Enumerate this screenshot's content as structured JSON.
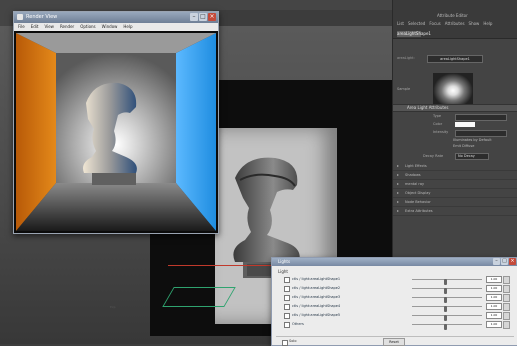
{
  "render_window": {
    "title": "Render View",
    "menu": [
      "File",
      "Edit",
      "View",
      "Render",
      "Options",
      "Window",
      "Help"
    ],
    "left_wall_color": "#e4891a",
    "right_wall_color": "#1f8de0"
  },
  "viewport": {
    "wall_color": "#c2c2c2",
    "shadow_color": "#0d0d0d"
  },
  "attribute_editor": {
    "title": "Attribute Editor",
    "tabs": [
      "List",
      "Selected",
      "Focus",
      "Attributes",
      "Show",
      "Help"
    ],
    "node_tab": "areaLightShape1",
    "node_label": "areaLight:",
    "node_field": "areaLightShape1",
    "sample_label": "Sample",
    "section_label": "Area Light Attributes",
    "rows": [
      {
        "label": "Type",
        "value": ""
      },
      {
        "label": "Color",
        "value": ""
      },
      {
        "label": "Intensity",
        "value": ""
      }
    ],
    "checks": [
      "Illuminates by Default",
      "Emit Diffuse"
    ],
    "decay_label": "Decay Rate",
    "decay_value": "No Decay",
    "collapsed_sections": [
      "Light Effects",
      "Shadows",
      "mental ray",
      "Object Display",
      "Node Behavior",
      "Extra Attributes"
    ]
  },
  "light_dialog": {
    "title": "Lights",
    "section_label": "Light",
    "rows": [
      {
        "name": "ctls / light:areaLightShape1",
        "value": "1.00",
        "pos": 0.45
      },
      {
        "name": "ctls / light:areaLightShape2",
        "value": "1.00",
        "pos": 0.45
      },
      {
        "name": "ctls / light:areaLightShape3",
        "value": "1.00",
        "pos": 0.45
      },
      {
        "name": "ctls / light:areaLightShape4",
        "value": "1.00",
        "pos": 0.45
      },
      {
        "name": "ctls / light:areaLightShape5",
        "value": "1.00",
        "pos": 0.45
      },
      {
        "name": "Others",
        "value": "1.00",
        "pos": 0.45
      }
    ],
    "mid_label": "Exp",
    "bottom_check_label": "Solo",
    "reset_label": "Reset"
  }
}
